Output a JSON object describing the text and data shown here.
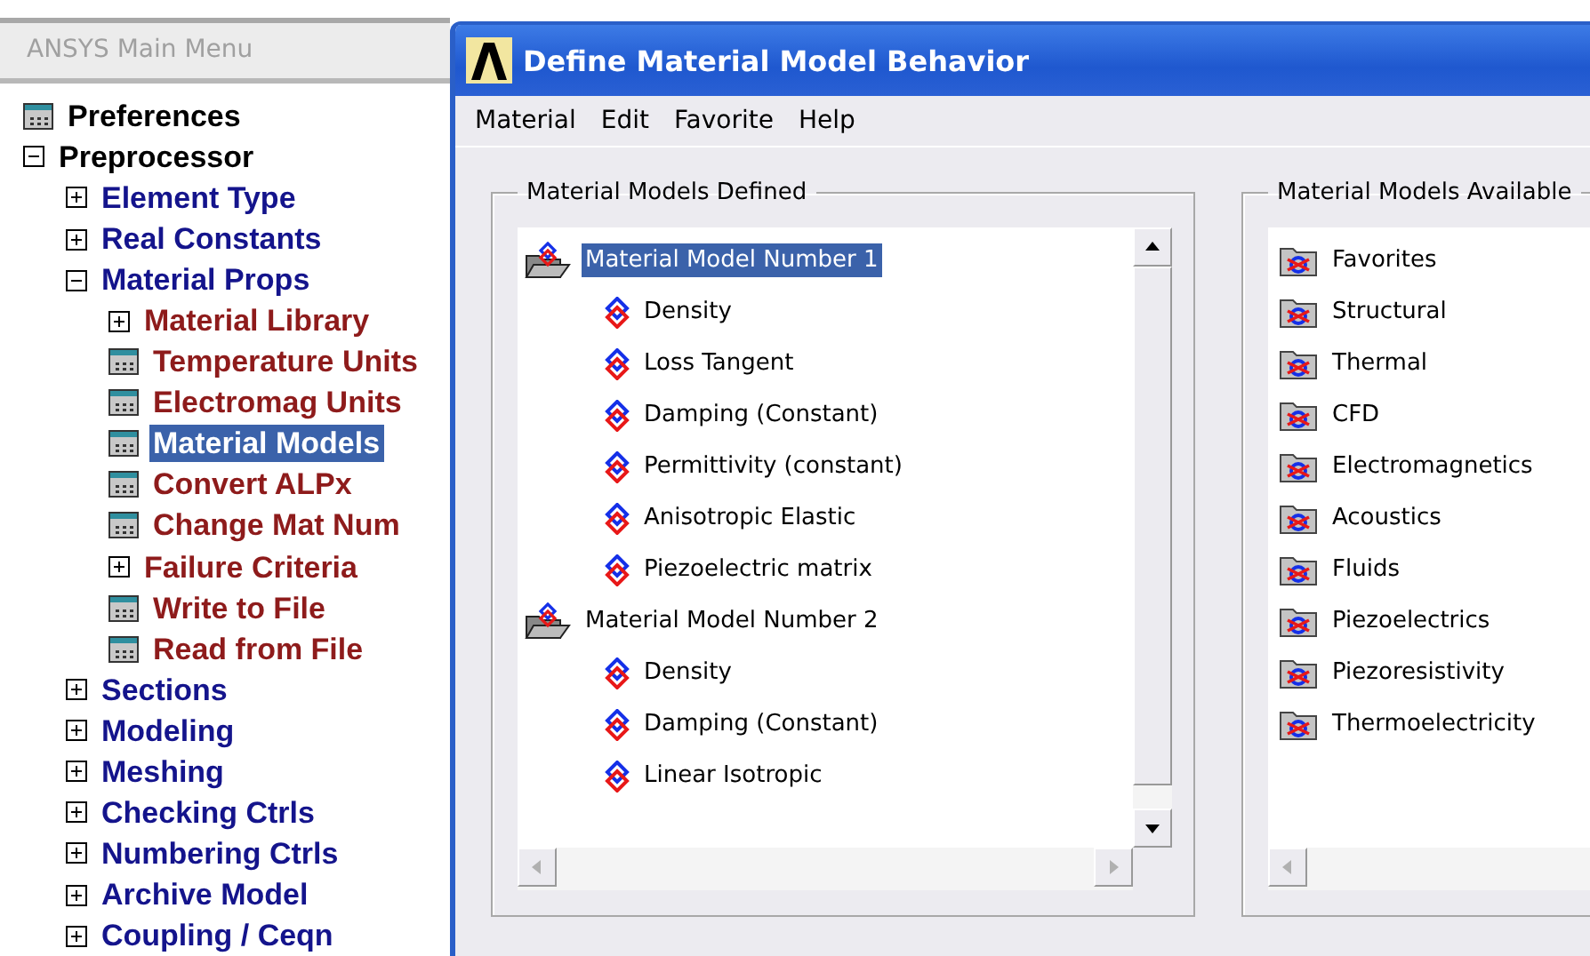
{
  "main_menu": {
    "title": "ANSYS Main Menu",
    "items": [
      {
        "label": "Preferences",
        "kind": "command",
        "selected": false
      },
      {
        "label": "Preprocessor",
        "kind": "folder",
        "expanded": true,
        "selected": false,
        "children": [
          {
            "label": "Element Type",
            "kind": "folder",
            "expanded": false,
            "selected": false
          },
          {
            "label": "Real Constants",
            "kind": "folder",
            "expanded": false,
            "selected": false
          },
          {
            "label": "Material Props",
            "kind": "folder",
            "expanded": true,
            "selected": false,
            "children": [
              {
                "label": "Material Library",
                "kind": "folder",
                "expanded": false,
                "selected": false
              },
              {
                "label": "Temperature Units",
                "kind": "command",
                "selected": false
              },
              {
                "label": "Electromag Units",
                "kind": "command",
                "selected": false
              },
              {
                "label": "Material Models",
                "kind": "command",
                "selected": true
              },
              {
                "label": "Convert ALPx",
                "kind": "command",
                "selected": false
              },
              {
                "label": "Change Mat Num",
                "kind": "command",
                "selected": false
              },
              {
                "label": "Failure Criteria",
                "kind": "folder",
                "expanded": false,
                "selected": false
              },
              {
                "label": "Write to File",
                "kind": "command",
                "selected": false
              },
              {
                "label": "Read from File",
                "kind": "command",
                "selected": false
              }
            ]
          },
          {
            "label": "Sections",
            "kind": "folder",
            "expanded": false,
            "selected": false
          },
          {
            "label": "Modeling",
            "kind": "folder",
            "expanded": false,
            "selected": false
          },
          {
            "label": "Meshing",
            "kind": "folder",
            "expanded": false,
            "selected": false
          },
          {
            "label": "Checking Ctrls",
            "kind": "folder",
            "expanded": false,
            "selected": false
          },
          {
            "label": "Numbering Ctrls",
            "kind": "folder",
            "expanded": false,
            "selected": false
          },
          {
            "label": "Archive Model",
            "kind": "folder",
            "expanded": false,
            "selected": false
          },
          {
            "label": "Coupling / Ceqn",
            "kind": "folder",
            "expanded": false,
            "selected": false
          }
        ]
      }
    ]
  },
  "dialog": {
    "title": "Define Material Model Behavior",
    "menu": [
      "Material",
      "Edit",
      "Favorite",
      "Help"
    ],
    "defined": {
      "title": "Material Models Defined",
      "models": [
        {
          "label": "Material Model Number 1",
          "selected": true,
          "children": [
            {
              "label": "Density",
              "selected": false
            },
            {
              "label": "Loss Tangent",
              "selected": false
            },
            {
              "label": "Damping (Constant)",
              "selected": false
            },
            {
              "label": "Permittivity (constant)",
              "selected": false
            },
            {
              "label": "Anisotropic Elastic",
              "selected": false
            },
            {
              "label": "Piezoelectric matrix",
              "selected": false
            }
          ]
        },
        {
          "label": "Material Model Number 2",
          "selected": false,
          "children": [
            {
              "label": "Density",
              "selected": false
            },
            {
              "label": "Damping (Constant)",
              "selected": false
            },
            {
              "label": "Linear Isotropic",
              "selected": false
            }
          ]
        }
      ]
    },
    "available": {
      "title": "Material Models Available",
      "categories": [
        {
          "label": "Favorites",
          "selected": false
        },
        {
          "label": "Structural",
          "selected": false
        },
        {
          "label": "Thermal",
          "selected": false
        },
        {
          "label": "CFD",
          "selected": false
        },
        {
          "label": "Electromagnetics",
          "selected": false
        },
        {
          "label": "Acoustics",
          "selected": false
        },
        {
          "label": "Fluids",
          "selected": false
        },
        {
          "label": "Piezoelectrics",
          "selected": false
        },
        {
          "label": "Piezoresistivity",
          "selected": false
        },
        {
          "label": "Thermoelectricity",
          "selected": false
        }
      ]
    }
  }
}
